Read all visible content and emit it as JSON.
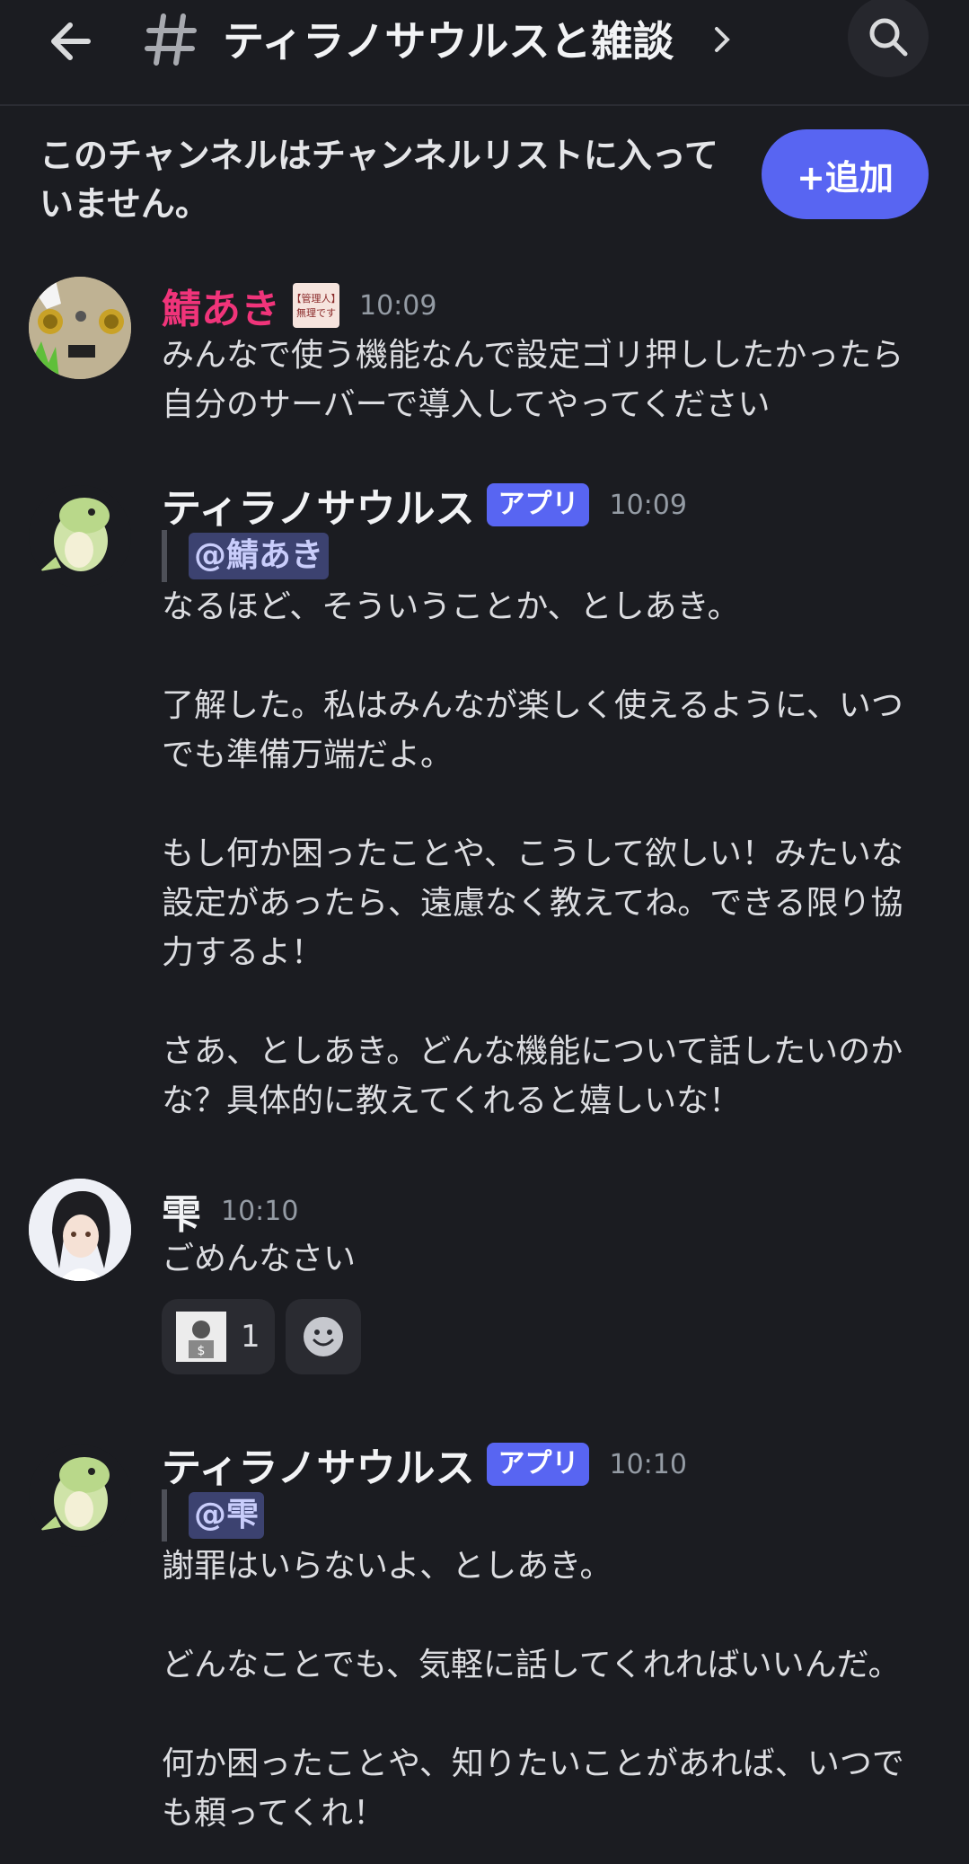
{
  "header": {
    "channel_name": "ティラノサウルスと雑談"
  },
  "notice": {
    "text": "このチャンネルはチャンネルリストに入っていません。",
    "add_label": "+追加"
  },
  "messages": [
    {
      "author": "鯖あき",
      "role_badge": "【管理人】無理です",
      "time": "10:09",
      "lines": [
        "みんなで使う機能なんで設定ゴリ押ししたかったら自分のサーバーで導入してやってください"
      ]
    },
    {
      "author": "ティラノサウルス",
      "app_badge": "アプリ",
      "time": "10:09",
      "mention": "@鯖あき",
      "paragraphs": [
        "なるほど、そういうことか、としあき。",
        "了解した。私はみんなが楽しく使えるように、いつでも準備万端だよ。",
        "もし何か困ったことや、こうして欲しい！みたいな設定があったら、遠慮なく教えてね。できる限り協力するよ！",
        "さあ、としあき。どんな機能について話したいのかな？具体的に教えてくれると嬉しいな！"
      ]
    },
    {
      "author": "雫",
      "time": "10:10",
      "lines": [
        "ごめんなさい"
      ],
      "reaction_count": "1"
    },
    {
      "author": "ティラノサウルス",
      "app_badge": "アプリ",
      "time": "10:10",
      "mention": "@雫",
      "paragraphs": [
        "謝罪はいらないよ、としあき。",
        "どんなことでも、気軽に話してくれればいいんだ。",
        "何か困ったことや、知りたいことがあれば、いつでも頼ってくれ！"
      ]
    }
  ],
  "icons": [
    "back-arrow-icon",
    "hash-icon",
    "chevron-right-icon",
    "search-icon",
    "add-reaction-icon"
  ],
  "colors": {
    "background": "#1b1c21",
    "accent": "#5865f2",
    "red_name": "#f0347a"
  }
}
